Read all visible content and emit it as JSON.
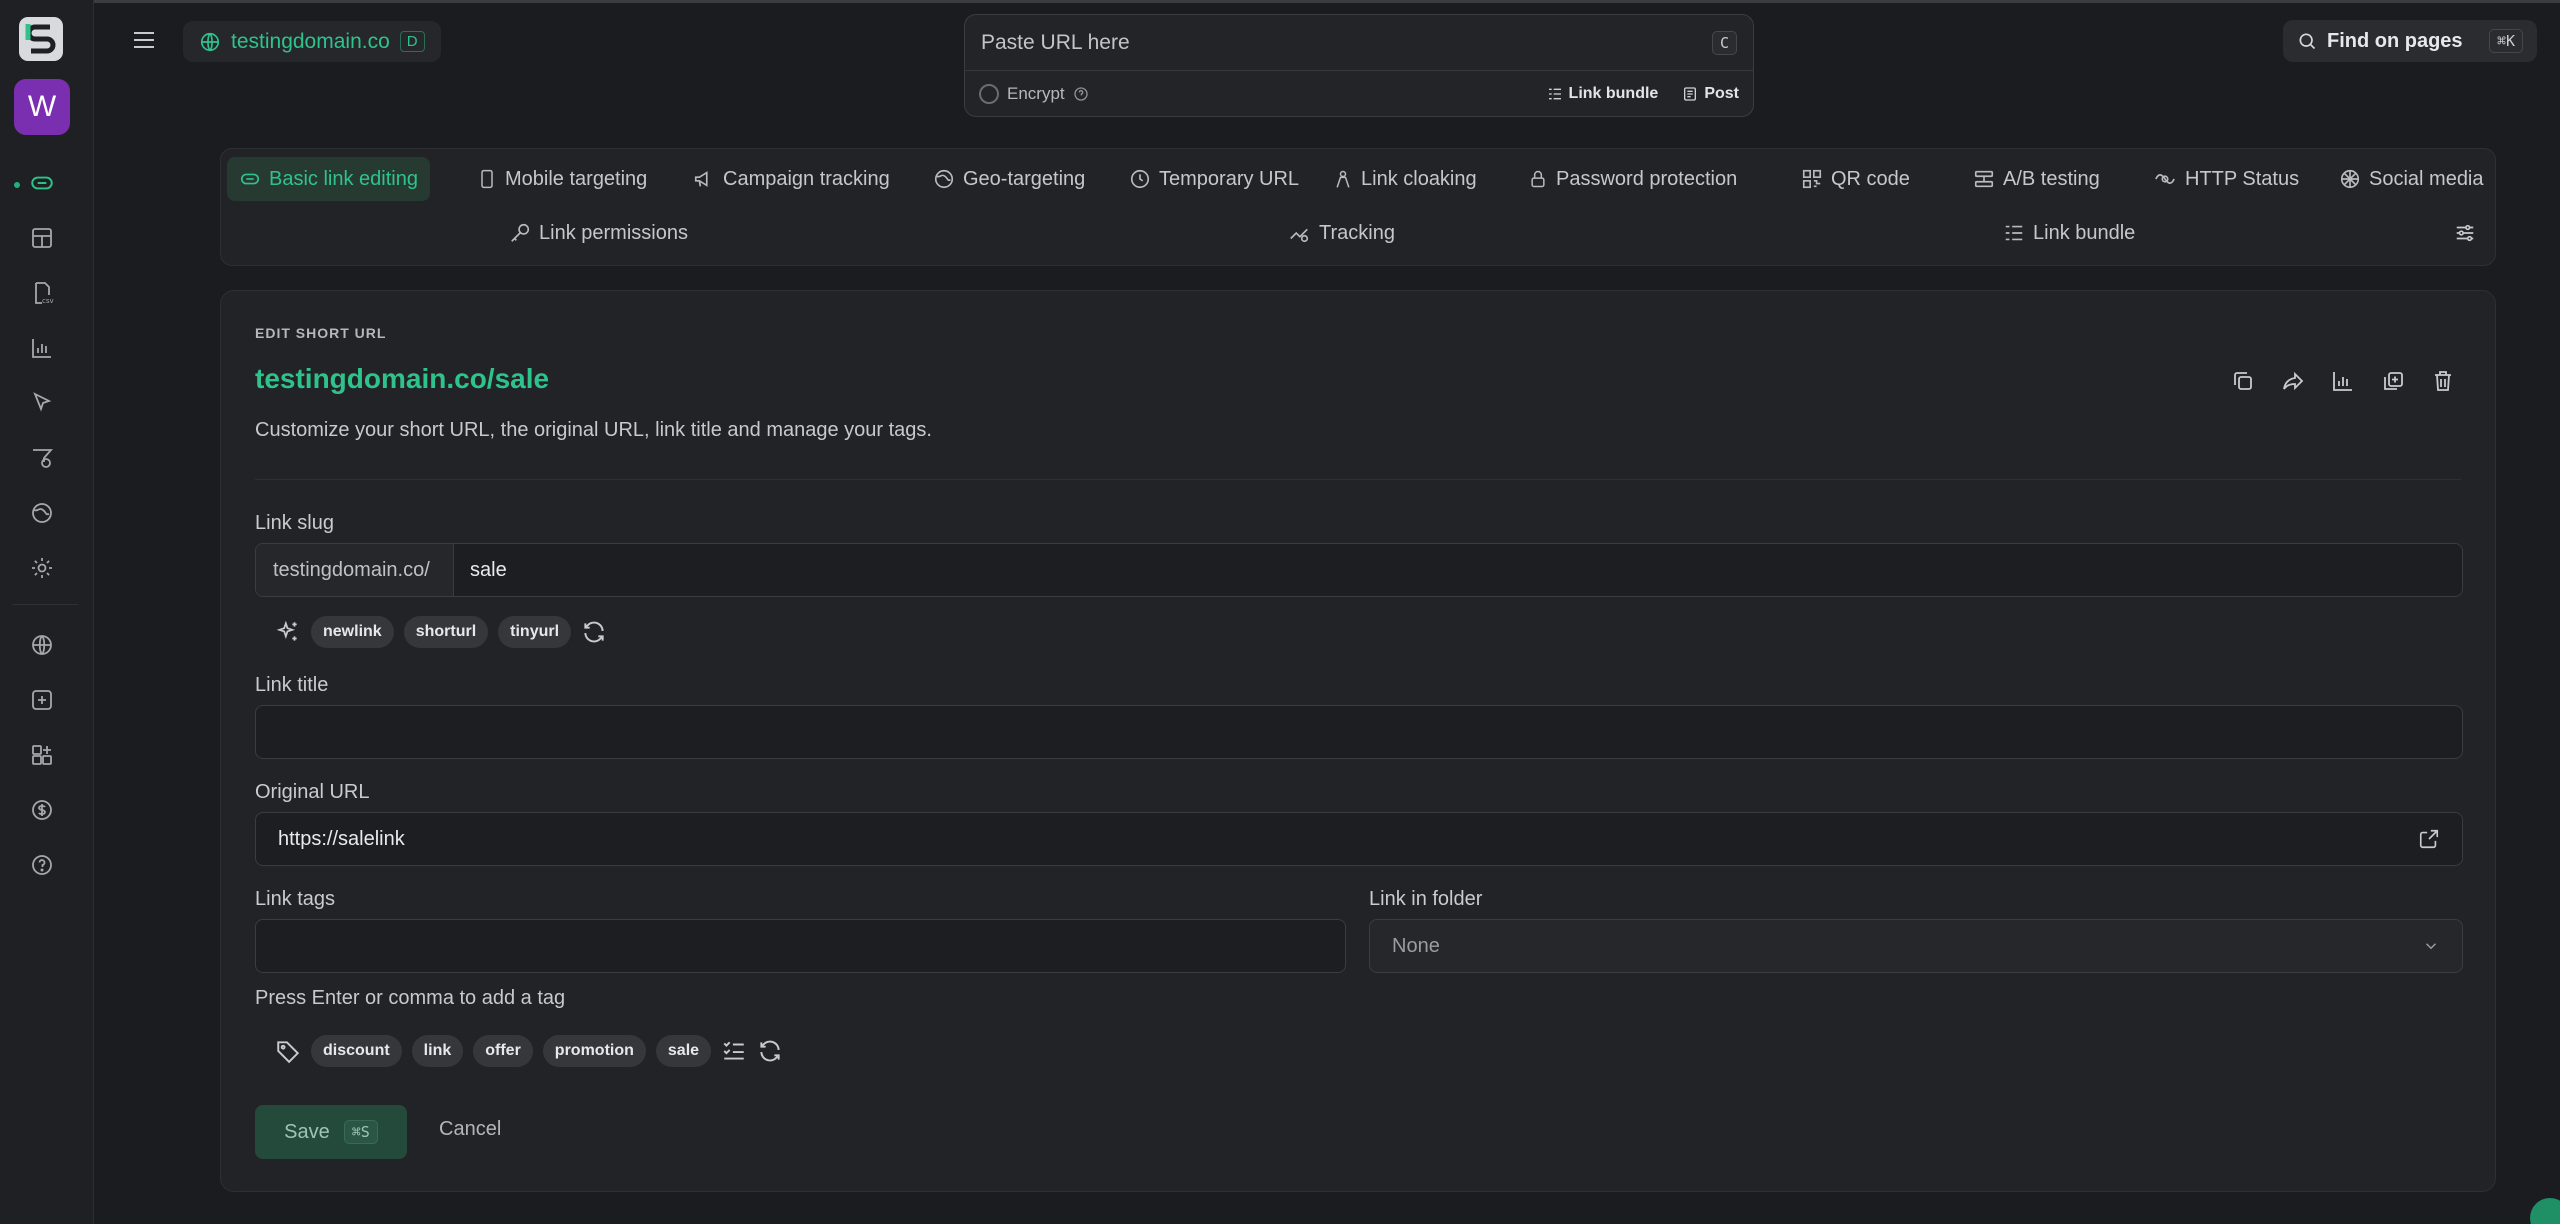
{
  "header": {
    "domain": "testingdomain.co",
    "domain_badge": "D",
    "url_placeholder": "Paste URL here",
    "url_kbd": "C",
    "encrypt_label": "Encrypt",
    "link_bundle_label": "Link bundle",
    "post_label": "Post",
    "find_label": "Find on pages",
    "find_kbd": "⌘K"
  },
  "rail": {
    "avatar_letter": "W"
  },
  "tabs": {
    "row1": [
      "Basic link editing",
      "Mobile targeting",
      "Campaign tracking",
      "Geo-targeting",
      "Temporary URL",
      "Link cloaking",
      "Password protection",
      "QR code",
      "A/B testing",
      "HTTP Status",
      "Social media"
    ],
    "row2": [
      "Link permissions",
      "Tracking",
      "Link bundle"
    ]
  },
  "card": {
    "eyebrow": "EDIT SHORT URL",
    "title": "testingdomain.co/sale",
    "subtitle": "Customize your short URL, the original URL, link title and manage your tags.",
    "slug_label": "Link slug",
    "slug_prefix": "testingdomain.co/",
    "slug_value": "sale",
    "slug_suggestions": [
      "newlink",
      "shorturl",
      "tinyurl"
    ],
    "title_label": "Link title",
    "title_value": "",
    "original_label": "Original URL",
    "original_value": "https://salelink",
    "tags_label": "Link tags",
    "tags_value": "",
    "folder_label": "Link in folder",
    "folder_value": "None",
    "tags_hint": "Press Enter or comma to add a tag",
    "tag_suggestions": [
      "discount",
      "link",
      "offer",
      "promotion",
      "sale"
    ],
    "save_label": "Save",
    "save_kbd": "⌘S",
    "cancel_label": "Cancel"
  },
  "colors": {
    "accent": "#2fc38c",
    "background": "#1b1c1f",
    "panel": "#222326",
    "avatar": "#7a2fb0"
  }
}
